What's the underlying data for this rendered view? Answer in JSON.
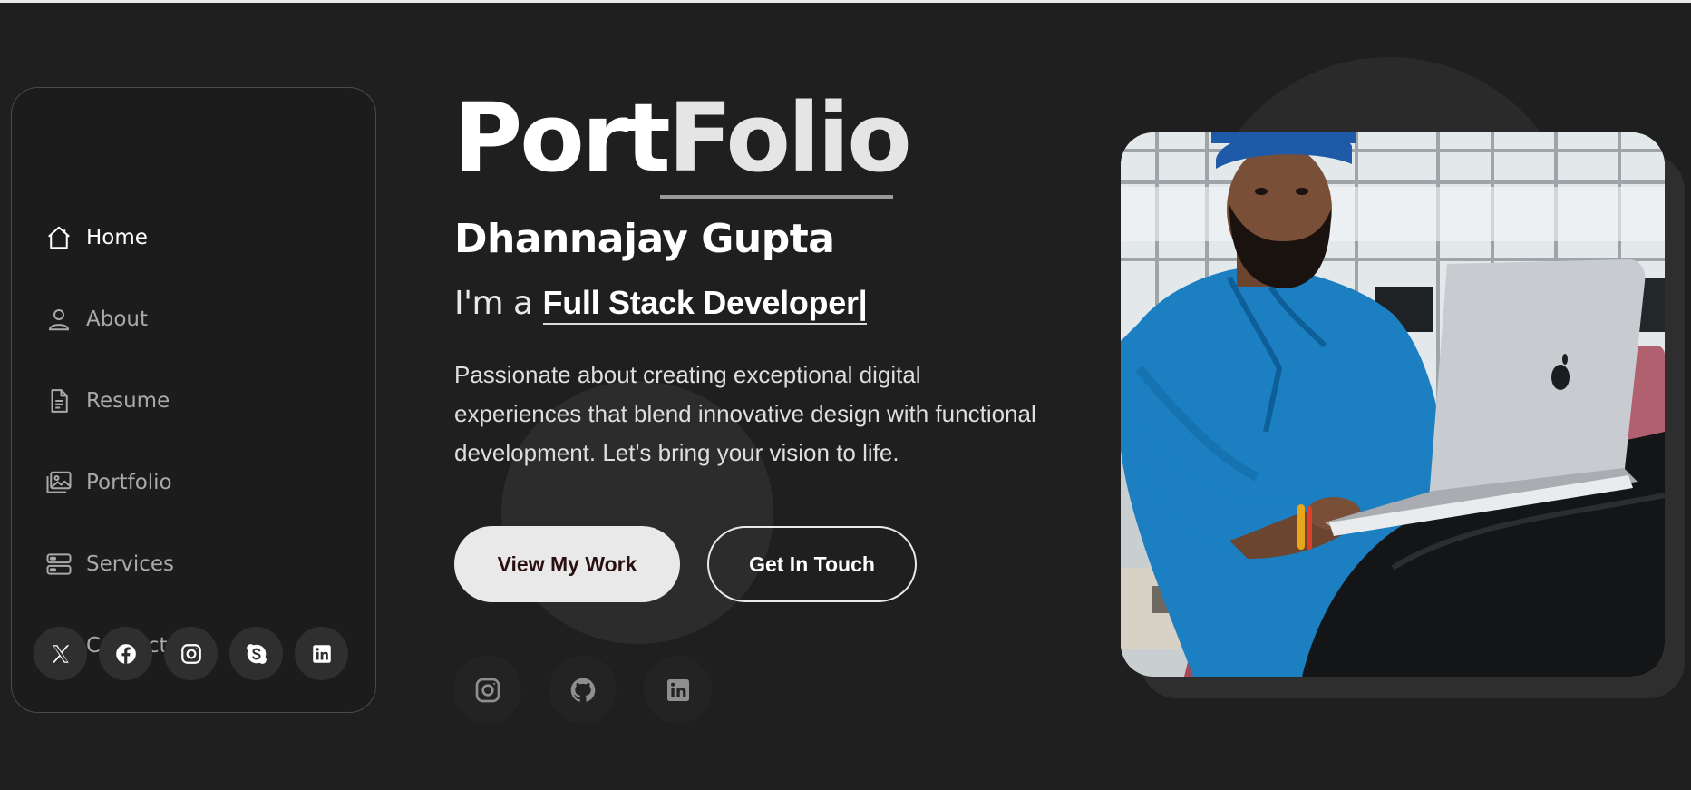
{
  "nav": {
    "items": [
      {
        "label": "Home",
        "icon": "home-icon",
        "active": true
      },
      {
        "label": "About",
        "icon": "user-icon",
        "active": false
      },
      {
        "label": "Resume",
        "icon": "document-icon",
        "active": false
      },
      {
        "label": "Portfolio",
        "icon": "image-icon",
        "active": false
      },
      {
        "label": "Services",
        "icon": "server-icon",
        "active": false
      },
      {
        "label": "Contact",
        "icon": "envelope-icon",
        "active": false
      }
    ],
    "socials": [
      "x-icon",
      "facebook-icon",
      "instagram-icon",
      "skype-icon",
      "linkedin-icon"
    ]
  },
  "hero": {
    "title_part1": "Port",
    "title_part2": "Folio",
    "name": "Dhannajay Gupta",
    "role_prefix": "I'm a ",
    "role": "Full Stack Developer|",
    "description": "Passionate about creating exceptional digital experiences that blend innovative design with functional development. Let's bring your vision to life.",
    "primary_button": "View My Work",
    "secondary_button": "Get In Touch",
    "socials": [
      "instagram-icon",
      "github-icon",
      "linkedin-icon"
    ]
  },
  "colors": {
    "background": "#1f1f1f",
    "accent": "#e9e9e9",
    "muted_text": "#a9a9a9"
  }
}
